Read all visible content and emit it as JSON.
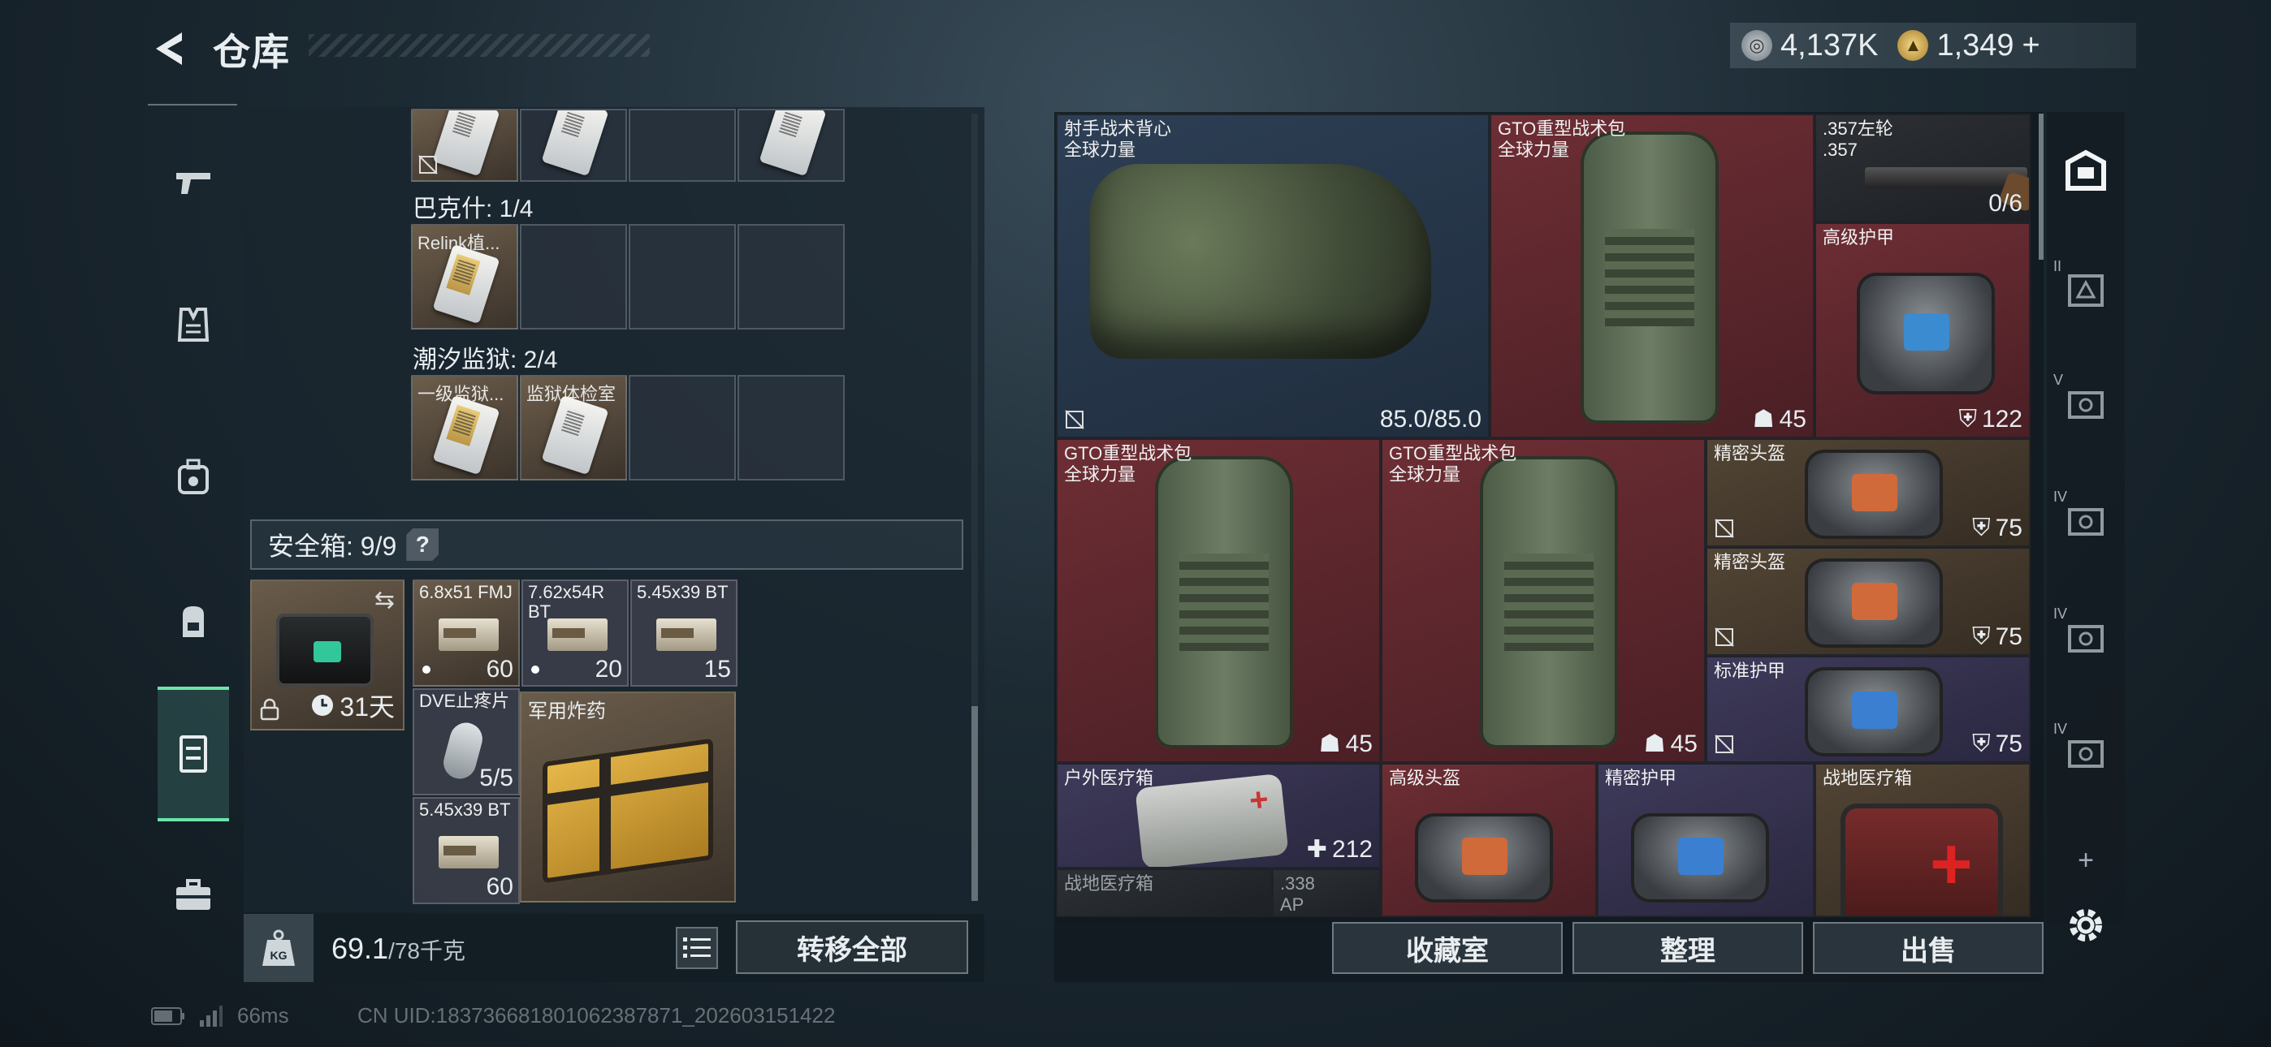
{
  "header": {
    "title": "仓库",
    "currency_silver": "4,137K",
    "currency_gold": "1,349",
    "gold_plus": "+"
  },
  "left_nav": [
    "weapons-icon",
    "vest-icon",
    "armor-bag-icon",
    "backpack-icon",
    "storage-icon",
    "briefcase-icon"
  ],
  "keycard_groups": [
    {
      "label": "巴克什: 1/4",
      "slots": [
        "Relink植..."
      ]
    },
    {
      "label": "潮汐监狱: 2/4",
      "slots": [
        "一级监狱...",
        "监狱体检室"
      ]
    }
  ],
  "safe_box": {
    "title": "安全箱: 9/9",
    "help": "?",
    "timer": "31天",
    "items": [
      {
        "name": "6.8x51 FMJ",
        "count": "60"
      },
      {
        "name": "7.62x54R BT",
        "count": "20"
      },
      {
        "name": "5.45x39 BT",
        "count": "15"
      },
      {
        "name": "DVE止疼片",
        "count": "5/5"
      },
      {
        "name": "军用炸药",
        "count": ""
      },
      {
        "name": "5.45x39 BT",
        "count": "60"
      }
    ]
  },
  "left_footer": {
    "weight_current": "69.1",
    "weight_max": "/78千克",
    "kg_label": "KG",
    "transfer_all": "转移全部"
  },
  "stash": [
    {
      "name": "射手战术背心",
      "sub": "全球力量",
      "value": "85.0/85.0"
    },
    {
      "name": "GTO重型战术包",
      "sub": "全球力量",
      "value": "45"
    },
    {
      "name": ".357左轮",
      "sub": ".357",
      "value": "0/6"
    },
    {
      "name": "高级护甲",
      "sub": "",
      "value": "122"
    },
    {
      "name": "GTO重型战术包",
      "sub": "全球力量",
      "value": "45"
    },
    {
      "name": "GTO重型战术包",
      "sub": "全球力量",
      "value": "45"
    },
    {
      "name": "精密头盔",
      "sub": "",
      "value": "75"
    },
    {
      "name": "精密头盔",
      "sub": "",
      "value": "75"
    },
    {
      "name": "标准护甲",
      "sub": "",
      "value": "75"
    },
    {
      "name": "户外医疗箱",
      "sub": "",
      "value": "212"
    },
    {
      "name": "高级头盔",
      "sub": "",
      "value": ""
    },
    {
      "name": "精密护甲",
      "sub": "",
      "value": ""
    },
    {
      "name": "战地医疗箱",
      "sub": "",
      "value": ""
    },
    {
      "name": "战地医疗箱",
      "sub": "",
      "value": ""
    },
    {
      "name": ".338",
      "sub": "AP",
      "value": ""
    }
  ],
  "right_tabs": [
    "locker-icon",
    "tab-2-icon",
    "tab-5-icon",
    "tab-4-icon",
    "tab-4b-icon",
    "tab-4c-icon"
  ],
  "right_tab_numerals": [
    "II",
    "V",
    "IV",
    "IV",
    "IV"
  ],
  "add_tab": "+",
  "actions": {
    "collection": "收藏室",
    "sort": "整理",
    "sell": "出售"
  },
  "status": {
    "ping": "66ms",
    "uid": "CN UID:18373668180106238787​1_202603151422"
  }
}
